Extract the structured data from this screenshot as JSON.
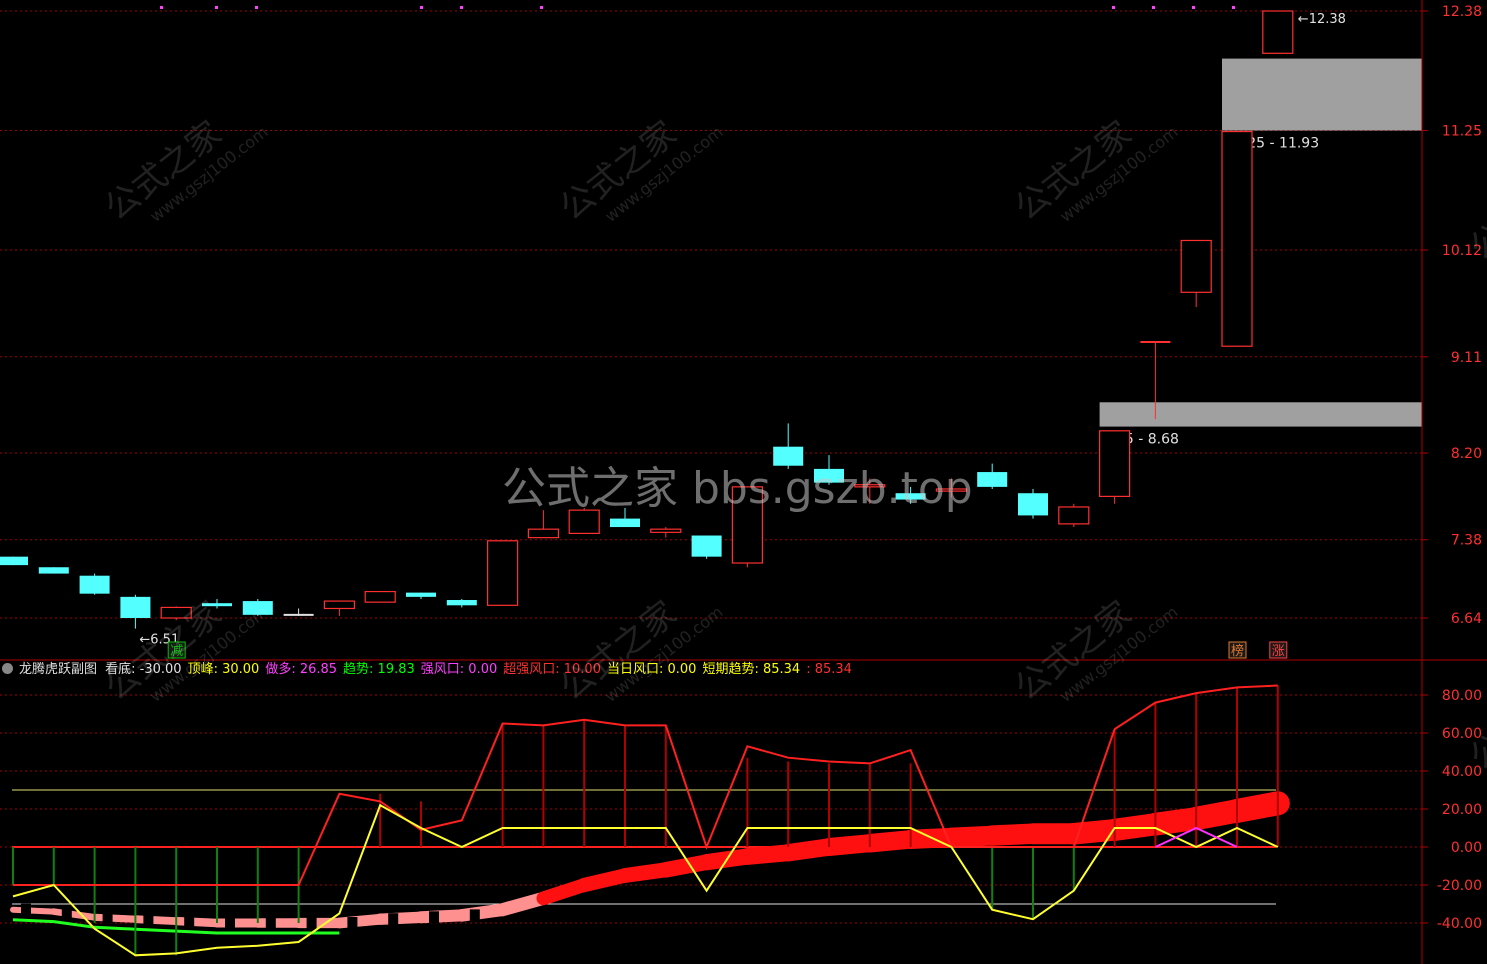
{
  "main_chart": {
    "y_ticks": [
      "12.38",
      "11.25",
      "10.12",
      "9.11",
      "8.20",
      "7.38",
      "6.64"
    ],
    "candles": [
      {
        "o": 7.22,
        "c": 7.14,
        "h": 7.22,
        "l": 7.14,
        "dir": "down"
      },
      {
        "o": 7.12,
        "c": 7.06,
        "h": 7.12,
        "l": 7.06,
        "dir": "down"
      },
      {
        "o": 7.04,
        "c": 6.87,
        "h": 7.06,
        "l": 6.86,
        "dir": "down"
      },
      {
        "o": 6.84,
        "c": 6.64,
        "h": 6.86,
        "l": 6.54,
        "dir": "down"
      },
      {
        "o": 6.64,
        "c": 6.74,
        "h": 6.75,
        "l": 6.62,
        "dir": "up"
      },
      {
        "o": 6.78,
        "c": 6.76,
        "h": 6.82,
        "l": 6.73,
        "dir": "down"
      },
      {
        "o": 6.8,
        "c": 6.67,
        "h": 6.82,
        "l": 6.66,
        "dir": "down"
      },
      {
        "o": 6.67,
        "c": 6.67,
        "h": 6.73,
        "l": 6.66,
        "dir": "flat"
      },
      {
        "o": 6.73,
        "c": 6.8,
        "h": 6.8,
        "l": 6.66,
        "dir": "up"
      },
      {
        "o": 6.79,
        "c": 6.89,
        "h": 6.89,
        "l": 6.79,
        "dir": "up"
      },
      {
        "o": 6.88,
        "c": 6.84,
        "h": 6.88,
        "l": 6.82,
        "dir": "down"
      },
      {
        "o": 6.81,
        "c": 6.76,
        "h": 6.82,
        "l": 6.74,
        "dir": "down"
      },
      {
        "o": 6.76,
        "c": 7.37,
        "h": 7.37,
        "l": 6.76,
        "dir": "up"
      },
      {
        "o": 7.4,
        "c": 7.48,
        "h": 7.66,
        "l": 7.4,
        "dir": "up"
      },
      {
        "o": 7.44,
        "c": 7.66,
        "h": 7.68,
        "l": 7.44,
        "dir": "up"
      },
      {
        "o": 7.58,
        "c": 7.5,
        "h": 7.68,
        "l": 7.5,
        "dir": "down"
      },
      {
        "o": 7.45,
        "c": 7.48,
        "h": 7.5,
        "l": 7.4,
        "dir": "up"
      },
      {
        "o": 7.42,
        "c": 7.22,
        "h": 7.42,
        "l": 7.2,
        "dir": "down"
      },
      {
        "o": 7.16,
        "c": 7.88,
        "h": 7.88,
        "l": 7.12,
        "dir": "up"
      },
      {
        "o": 8.26,
        "c": 8.08,
        "h": 8.48,
        "l": 8.05,
        "dir": "down"
      },
      {
        "o": 8.05,
        "c": 7.92,
        "h": 8.18,
        "l": 7.9,
        "dir": "down"
      },
      {
        "o": 7.9,
        "c": 7.88,
        "h": 7.96,
        "l": 7.72,
        "dir": "up"
      },
      {
        "o": 7.82,
        "c": 7.76,
        "h": 7.88,
        "l": 7.72,
        "dir": "down"
      },
      {
        "o": 7.84,
        "c": 7.86,
        "h": 7.96,
        "l": 7.78,
        "dir": "up"
      },
      {
        "o": 8.02,
        "c": 7.88,
        "h": 8.1,
        "l": 7.86,
        "dir": "down"
      },
      {
        "o": 7.82,
        "c": 7.61,
        "h": 7.86,
        "l": 7.58,
        "dir": "down"
      },
      {
        "o": 7.53,
        "c": 7.69,
        "h": 7.72,
        "l": 7.5,
        "dir": "up"
      },
      {
        "o": 7.79,
        "c": 8.41,
        "h": 8.41,
        "l": 7.72,
        "dir": "up"
      },
      {
        "o": 9.25,
        "c": 9.25,
        "h": 9.25,
        "l": 8.52,
        "dir": "flat-up"
      },
      {
        "o": 9.72,
        "c": 10.21,
        "h": 10.21,
        "l": 9.58,
        "dir": "up"
      },
      {
        "o": 9.21,
        "c": 11.24,
        "h": 11.24,
        "l": 9.21,
        "dir": "up"
      },
      {
        "o": 11.98,
        "c": 12.38,
        "h": 12.38,
        "l": 11.98,
        "dir": "up"
      }
    ],
    "gaps": [
      {
        "low": 8.45,
        "high": 8.68,
        "label": "8.45 - 8.68",
        "from_candle": 27
      },
      {
        "low": 11.25,
        "high": 11.93,
        "label": "11.25 - 11.93",
        "from_candle": 30
      }
    ],
    "low_marker": "6.51",
    "high_marker": "12.38",
    "signals": [
      {
        "candle": 4,
        "text": "减",
        "color": "#00c000"
      },
      {
        "candle": 30,
        "text": "榜",
        "color": "#e07830"
      },
      {
        "candle": 31,
        "text": "涨",
        "color": "#ff4040"
      }
    ]
  },
  "indicator": {
    "title": "龙腾虎跃副图",
    "fields": [
      {
        "label": "看底",
        "value": "-30.00",
        "color": "#e0e0e0"
      },
      {
        "label": "顶峰",
        "value": "30.00",
        "color": "#ffff00"
      },
      {
        "label": "做多",
        "value": "26.85",
        "color": "#ff40ff"
      },
      {
        "label": "趋势",
        "value": "19.83",
        "color": "#00ff00"
      },
      {
        "label": "强风口",
        "value": "0.00",
        "color": "#ff40ff"
      },
      {
        "label": "超强风口",
        "value": "10.00",
        "color": "#ff3030"
      },
      {
        "label": "当日风口",
        "value": "0.00",
        "color": "#ffff00"
      },
      {
        "label": "短期趋势",
        "value": "85.34",
        "color": "#ffff00"
      },
      {
        "label": "",
        "value": "85.34",
        "color": "#ff3030"
      }
    ],
    "y_ticks": [
      "80.00",
      "60.00",
      "40.00",
      "20.00",
      "0.00",
      "-20.00",
      "-40.00"
    ],
    "red_line": [
      -20,
      -20,
      -20,
      -20,
      -20,
      -20,
      -20,
      -20,
      28,
      24,
      9,
      14,
      65,
      64,
      67,
      64,
      64,
      0,
      53,
      47,
      45,
      44,
      51,
      0,
      0,
      0,
      0,
      62,
      76,
      81,
      84,
      85
    ],
    "yellow_line": [
      -26,
      -20,
      -43,
      -57,
      -56,
      -53,
      -52,
      -50,
      -35,
      22,
      10,
      0,
      10,
      10,
      10,
      10,
      10,
      -23,
      10,
      10,
      10,
      10,
      10,
      0,
      -33,
      -38,
      -23,
      10,
      10,
      0,
      10,
      0
    ],
    "trend_band": [
      -33,
      -34,
      -37,
      -38,
      -39,
      -40,
      -40,
      -40,
      -40,
      -38,
      -37,
      -36,
      -33,
      -27,
      -20,
      -15,
      -12,
      -8,
      -5,
      -3,
      0,
      2,
      4,
      5,
      6,
      7,
      7,
      9,
      12,
      15,
      19,
      23
    ],
    "bar_values": [
      -20,
      -20,
      -40,
      -57,
      -57,
      -40,
      -40,
      -40,
      0,
      28,
      24,
      0,
      65,
      64,
      67,
      64,
      64,
      0,
      47,
      45,
      44,
      44,
      44,
      0,
      -33,
      -38,
      -23,
      62,
      76,
      81,
      84,
      85
    ],
    "hline_top": 30,
    "hline_bottom": -30
  },
  "watermarks": {
    "center": "公式之家 bbs.gszb.top",
    "tile_main": "公式之家",
    "tile_sub": "www.gszj100.com"
  }
}
